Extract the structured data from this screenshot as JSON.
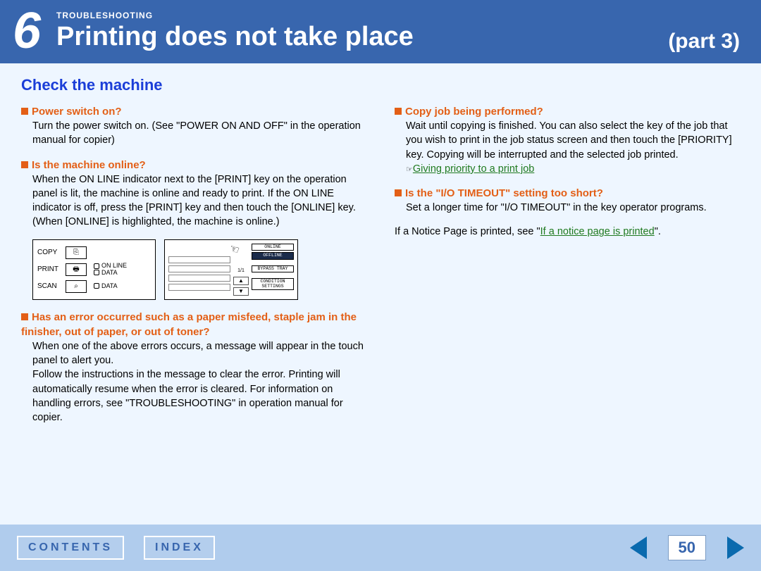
{
  "header": {
    "chapter_number": "6",
    "category": "TROUBLESHOOTING",
    "title": "Printing does not take place",
    "part": "(part 3)"
  },
  "section_title": "Check the machine",
  "left_items": [
    {
      "head": "Power switch on?",
      "body": "Turn the power switch on. (See \"POWER ON AND OFF\" in the operation manual for copier)"
    },
    {
      "head": "Is the machine online?",
      "body": "When the ON LINE indicator next to the [PRINT] key on the operation panel is lit, the machine is online and ready to print. If the ON LINE indicator is off, press the [PRINT] key and then touch the [ONLINE] key. (When [ONLINE] is highlighted, the machine is online.)"
    },
    {
      "head": "Has an error occurred such as a paper misfeed, staple jam in the finisher, out of paper, or out of toner?",
      "body": "When one of the above errors occurs, a message will appear in the touch panel to alert you.\nFollow the instructions in the message to clear the error. Printing will automatically resume when the error is cleared. For information on handling errors, see \"TROUBLESHOOTING\" in operation manual for copier."
    }
  ],
  "right_items": [
    {
      "head": "Copy job being performed?",
      "body": "Wait until copying is finished. You can also select the key of the job that you wish to print in the job status screen and then touch the [PRIORITY] key. Copying will be interrupted and the selected job printed.",
      "link_label": "Giving priority to a print job"
    },
    {
      "head": "Is the \"I/O TIMEOUT\" setting too short?",
      "body": "Set a longer time for \"I/O TIMEOUT\" in the key operator programs."
    }
  ],
  "notice_prefix": "If a Notice Page is printed, see \"",
  "notice_link": "If a notice page is printed",
  "notice_suffix": "\".",
  "panel": {
    "copy": "COPY",
    "print": "PRINT",
    "scan": "SCAN",
    "online": "ON LINE",
    "data1": "DATA",
    "data2": "DATA",
    "page": "1/1",
    "btn_online": "ONLINE",
    "btn_offline": "OFFLINE",
    "btn_bypass": "BYPASS TRAY",
    "btn_condition": "CONDITION\nSETTINGS"
  },
  "footer": {
    "contents": "CONTENTS",
    "index": "INDEX",
    "page": "50"
  }
}
